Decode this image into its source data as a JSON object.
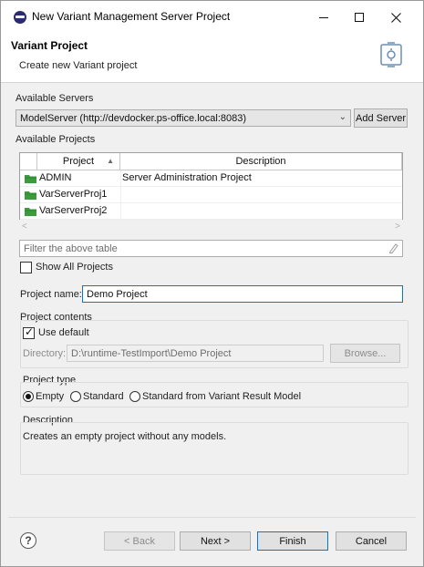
{
  "window": {
    "title": "New Variant Management Server Project"
  },
  "banner": {
    "title": "Variant Project",
    "subtitle": "Create new Variant project"
  },
  "servers": {
    "label": "Available Servers",
    "selected": "ModelServer (http://devdocker.ps-office.local:8083)",
    "add_button": "Add Server"
  },
  "projects": {
    "label": "Available Projects",
    "columns": [
      "Project",
      "Description"
    ],
    "rows": [
      {
        "name": "ADMIN",
        "description": "Server Administration Project"
      },
      {
        "name": "VarServerProj1",
        "description": ""
      },
      {
        "name": "VarServerProj2",
        "description": ""
      }
    ],
    "filter_placeholder": "Filter the above table",
    "show_all_label": "Show All Projects",
    "show_all_checked": false
  },
  "project_name": {
    "label": "Project name:",
    "value": "Demo Project"
  },
  "project_contents": {
    "label": "Project contents",
    "use_default_label": "Use default",
    "use_default_checked": true,
    "directory_label": "Directory:",
    "directory_value": "D:\\runtime-TestImport\\Demo Project",
    "browse_button": "Browse..."
  },
  "project_type": {
    "label": "Project type",
    "options": [
      "Empty",
      "Standard",
      "Standard from Variant Result Model"
    ],
    "selected": "Empty"
  },
  "description": {
    "label": "Description",
    "text": "Creates an empty project without any models."
  },
  "footer": {
    "help_glyph": "?",
    "back": "< Back",
    "next": "Next >",
    "finish": "Finish",
    "cancel": "Cancel"
  },
  "colors": {
    "accent_border": "#0078d7",
    "folder_green": "#3c9b3c"
  }
}
